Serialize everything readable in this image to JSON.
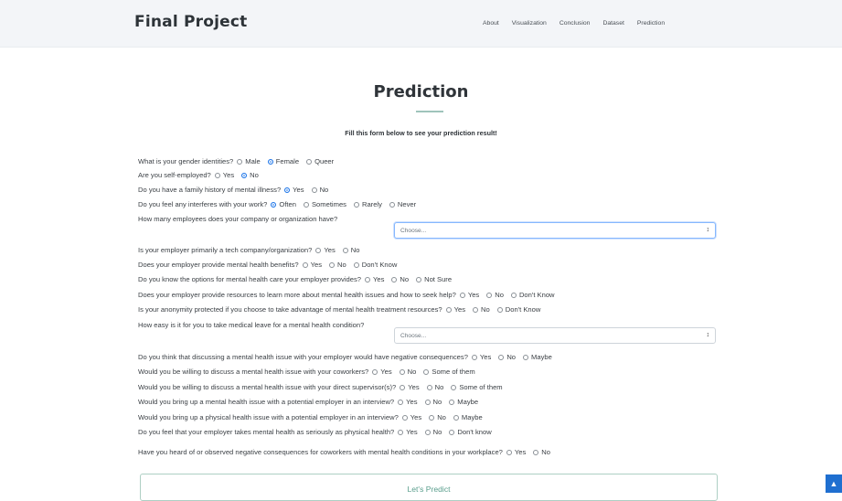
{
  "nav": {
    "brand": "Final Project",
    "links": [
      "About",
      "Visualization",
      "Conclusion",
      "Dataset",
      "Prediction"
    ]
  },
  "section": {
    "title": "Prediction",
    "subtitle": "Fill this form below to see your prediction result!"
  },
  "form": {
    "q1": {
      "text": "What is your gender identities?",
      "options": [
        "Male",
        "Female",
        "Queer"
      ],
      "selected": "Female"
    },
    "q2": {
      "text": "Are you self-employed?",
      "options": [
        "Yes",
        "No"
      ],
      "selected": "No"
    },
    "q3": {
      "text": "Do you have a family history of mental illness?",
      "options": [
        "Yes",
        "No"
      ],
      "selected": "Yes"
    },
    "q4": {
      "text": "Do you feel any interferes with your work?",
      "options": [
        "Often",
        "Sometimes",
        "Rarely",
        "Never"
      ],
      "selected": "Often"
    },
    "q5": {
      "text": "How many employees does your company or organization have?",
      "placeholder": "Choose..."
    },
    "q6": {
      "text": "Is your employer primarily a tech company/organization?",
      "options": [
        "Yes",
        "No"
      ],
      "selected": ""
    },
    "q7": {
      "text": "Does your employer provide mental health benefits?",
      "options": [
        "Yes",
        "No",
        "Don't Know"
      ],
      "selected": ""
    },
    "q8": {
      "text": "Do you know the options for mental health care your employer provides?",
      "options": [
        "Yes",
        "No",
        "Not Sure"
      ],
      "selected": ""
    },
    "q9": {
      "text": "Does your employer provide resources to learn more about mental health issues and how to seek help?",
      "options": [
        "Yes",
        "No",
        "Don't Know"
      ],
      "selected": ""
    },
    "q10": {
      "text": "Is your anonymity protected if you choose to take advantage of mental health treatment resources?",
      "options": [
        "Yes",
        "No",
        "Don't Know"
      ],
      "selected": ""
    },
    "q11": {
      "text": "How easy is it for you to take medical leave for a mental health condition?",
      "placeholder": "Choose..."
    },
    "q12": {
      "text": "Do you think that discussing a mental health issue with your employer would have negative consequences?",
      "options": [
        "Yes",
        "No",
        "Maybe"
      ],
      "selected": ""
    },
    "q13": {
      "text": "Would you be willing to discuss a mental health issue with your coworkers?",
      "options": [
        "Yes",
        "No",
        "Some of them"
      ],
      "selected": ""
    },
    "q14": {
      "text": "Would you be willing to discuss a mental health issue with your direct supervisor(s)?",
      "options": [
        "Yes",
        "No",
        "Some of them"
      ],
      "selected": ""
    },
    "q15": {
      "text": "Would you bring up a mental health issue with a potential employer in an interview?",
      "options": [
        "Yes",
        "No",
        "Maybe"
      ],
      "selected": ""
    },
    "q16": {
      "text": "Would you bring up a physical health issue with a potential employer in an interview?",
      "options": [
        "Yes",
        "No",
        "Maybe"
      ],
      "selected": ""
    },
    "q17": {
      "text": "Do you feel that your employer takes mental health as seriously as physical health?",
      "options": [
        "Yes",
        "No",
        "Don't know"
      ],
      "selected": ""
    },
    "q18": {
      "text": "Have you heard of or observed negative consequences for coworkers with mental health conditions in your workplace?",
      "options": [
        "Yes",
        "No"
      ],
      "selected": ""
    },
    "submit_label": "Let's Predict"
  },
  "icons": {
    "scroll_top": "arrow-up-icon",
    "select_arrow": "chevron-updown-icon"
  },
  "colors": {
    "accent": "#1a73e8",
    "button_text": "#5a9e8d",
    "navbar_bg": "#f3f5f8"
  }
}
